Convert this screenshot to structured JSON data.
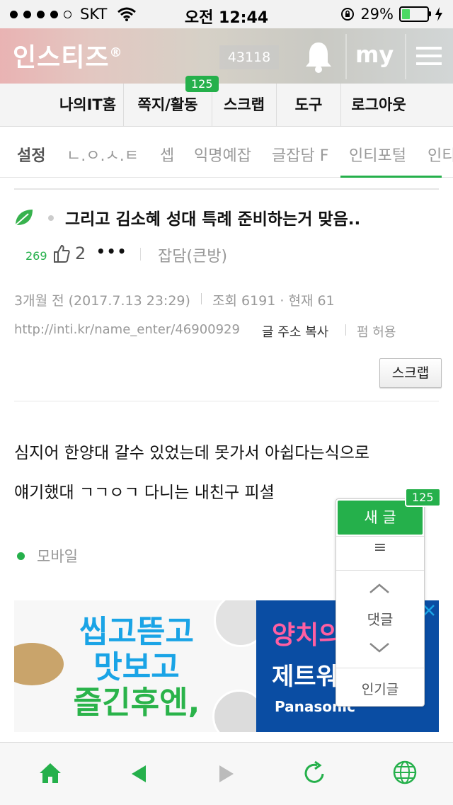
{
  "status_bar": {
    "carrier": "SKT",
    "time": "오전 12:44",
    "battery": "29%",
    "battery_level": 0.29,
    "icons": [
      "signal-dots",
      "wifi-icon",
      "orientation-lock-icon",
      "battery-icon",
      "charging-bolt-icon"
    ]
  },
  "header": {
    "logo": "인스티즈",
    "logo_mark": "®",
    "counter": "43118",
    "my_label": "my",
    "icons": [
      "bell-icon",
      "hamburger-menu-icon"
    ]
  },
  "menu": {
    "items": [
      "나의IT홈",
      "쪽지/활동",
      "스크랩",
      "도구",
      "로그아웃"
    ],
    "badge": "125"
  },
  "tabs": {
    "items": [
      "설정",
      "ㄴ.ㅇ.ㅅ.ㅌ",
      "셉",
      "익명예잡",
      "글잡담 F",
      "인티포털",
      "인티"
    ],
    "active_settings": "설정",
    "selected": "인티포털"
  },
  "post": {
    "title": "그리고 김소혜 성대 특례 준비하는거 맞음..",
    "level": "269",
    "likes": "2",
    "more": "•••",
    "board": "잡담(큰방)",
    "date": "3개월 전 (2017.7.13 23:29)",
    "views": "조회 6191 · 현재 61",
    "url": "http://inti.kr/name_enter/46900929",
    "copy_link": "글 주소 복사",
    "permission": "펌 허용",
    "scrap_button": "스크랩",
    "body_lines": [
      "심지어 한양대 갈수 있었는데 못가서 아쉽다는식으로",
      "얘기했대 ㄱㄱㅇㄱ 다니는 내친구 피셜"
    ],
    "device": "모바일"
  },
  "ad": {
    "left_lines": [
      "씹고뜯고",
      "맛보고",
      "즐긴후엔,"
    ],
    "right_line1": "양치의",
    "right_line2": "제트워",
    "right_brand": "Panasonic"
  },
  "floating_panel": {
    "new_post": "새 글",
    "badge": "125",
    "list_icon": "≡",
    "comments": "댓글",
    "popular": "인기글"
  },
  "bottom_bar": {
    "icons": [
      "home-icon",
      "back-arrow-icon",
      "forward-arrow-icon",
      "refresh-icon",
      "globe-icon"
    ]
  },
  "colors": {
    "accent_green": "#25b04b",
    "ad_blue": "#0a4da3"
  }
}
